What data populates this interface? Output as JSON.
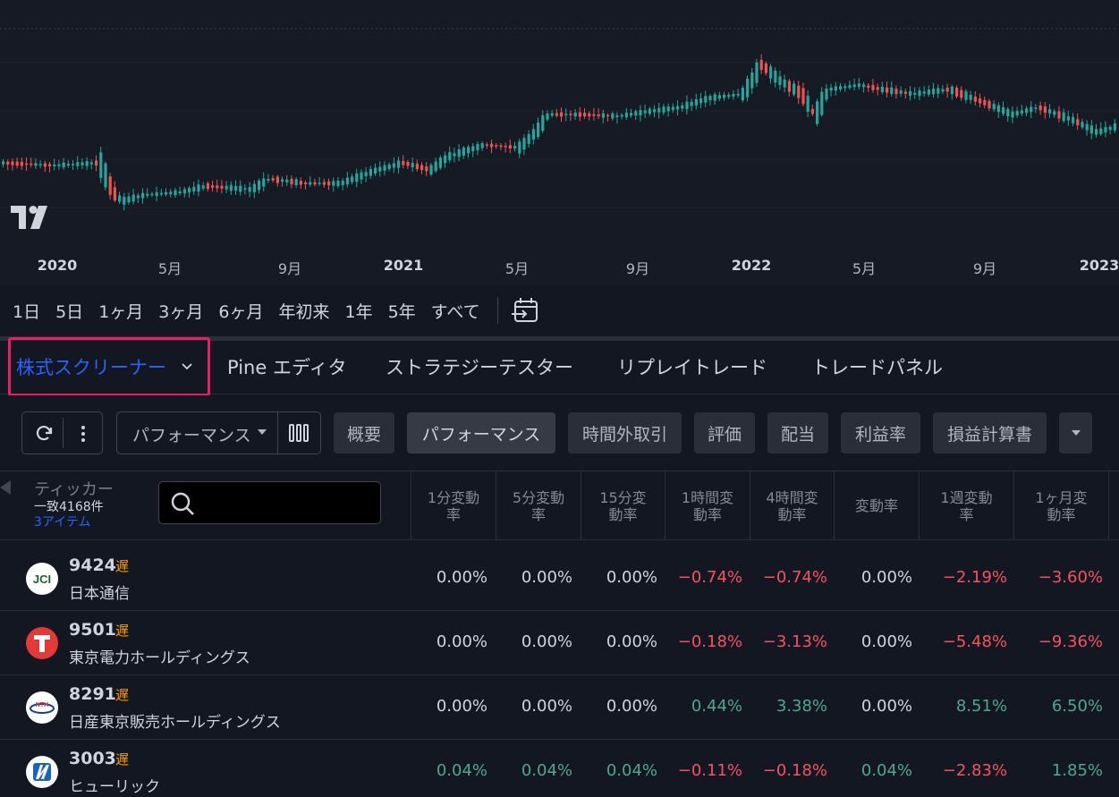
{
  "chart": {
    "x_axis_labels": [
      "2020",
      "5月",
      "9月",
      "2021",
      "5月",
      "9月",
      "2022",
      "5月",
      "9月",
      "2023"
    ],
    "colors": {
      "up": "#26a69a",
      "down": "#ef5350",
      "background": "#161a25"
    }
  },
  "range_bar": {
    "buttons": [
      "1日",
      "5日",
      "1ヶ月",
      "3ヶ月",
      "6ヶ月",
      "年初来",
      "1年",
      "5年",
      "すべて"
    ],
    "goto_icon": "calendar-arrow-icon"
  },
  "bottom_tabs": {
    "screener": "株式スクリーナー",
    "pine_editor": "Pine エディタ",
    "strategy_tester": "ストラテジーテスター",
    "replay": "リプレイトレード",
    "trade_panel": "トレードパネル"
  },
  "toolbar": {
    "refresh_icon": "refresh-icon",
    "more_icon": "more-vertical-icon",
    "preset_select": "パフォーマンス",
    "columns_icon": "columns-icon",
    "tabs": [
      "概要",
      "パフォーマンス",
      "時間外取引",
      "評価",
      "配当",
      "利益率",
      "損益計算書"
    ],
    "active_tab": "パフォーマンス",
    "overflow_icon": "caret-down-icon"
  },
  "table": {
    "ticker_title": "ティッカー",
    "match_count": "一致4168件",
    "item_count": "3アイテム",
    "search_placeholder": "",
    "columns": [
      "1分変動\n率",
      "5分変動\n率",
      "15分変\n動率",
      "1時間変\n動率",
      "4時間変\n動率",
      "変動率",
      "1週変動\n率",
      "1ヶ月変\n動率"
    ],
    "rows": [
      {
        "symbol": "9424",
        "delay": "遅",
        "name": "日本通信",
        "logo": "JCI",
        "values": [
          "0.00%",
          "0.00%",
          "0.00%",
          "−0.74%",
          "−0.74%",
          "0.00%",
          "−2.19%",
          "−3.60%"
        ]
      },
      {
        "symbol": "9501",
        "delay": "遅",
        "name": "東京電力ホールディングス",
        "logo": "T",
        "values": [
          "0.00%",
          "0.00%",
          "0.00%",
          "−0.18%",
          "−3.13%",
          "0.00%",
          "−5.48%",
          "−9.36%"
        ]
      },
      {
        "symbol": "8291",
        "delay": "遅",
        "name": "日産東京販売ホールディングス",
        "logo": "NTH",
        "values": [
          "0.00%",
          "0.00%",
          "0.00%",
          "0.44%",
          "3.38%",
          "0.00%",
          "8.51%",
          "6.50%"
        ]
      },
      {
        "symbol": "3003",
        "delay": "遅",
        "name": "ヒューリック",
        "logo": "H",
        "values": [
          "0.04%",
          "0.04%",
          "0.04%",
          "−0.11%",
          "−0.18%",
          "0.04%",
          "−2.83%",
          "1.85%"
        ]
      }
    ]
  }
}
